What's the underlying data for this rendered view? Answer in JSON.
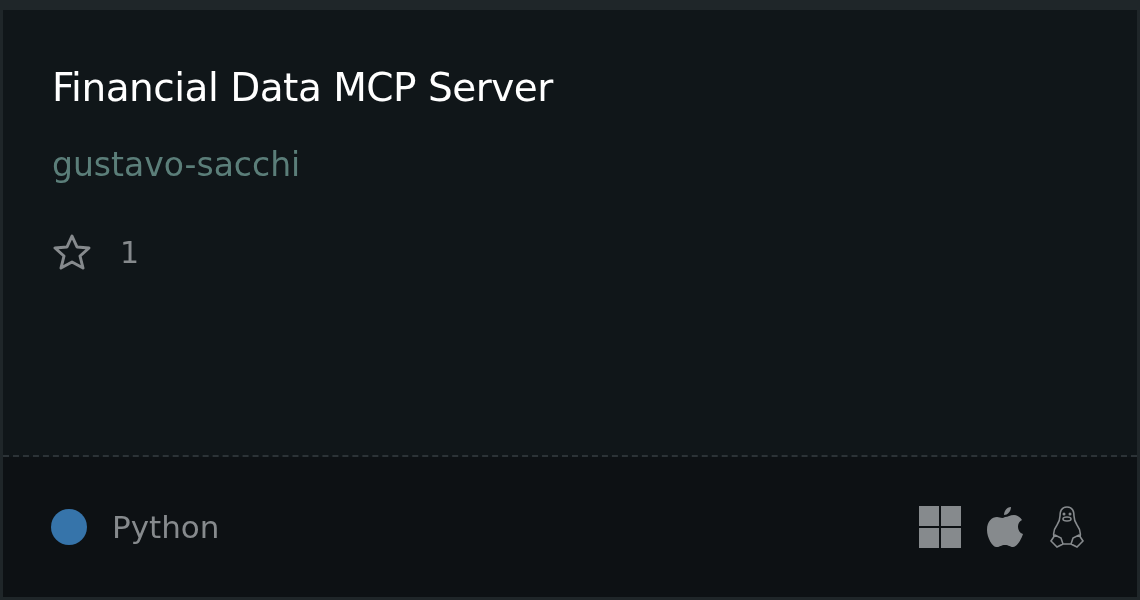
{
  "card": {
    "title": "Financial Data MCP Server",
    "author": "gustavo-sacchi",
    "star_count": "1"
  },
  "footer": {
    "language": {
      "name": "Python",
      "color": "#3674aa"
    },
    "platforms": [
      {
        "kind": "windows"
      },
      {
        "kind": "apple"
      },
      {
        "kind": "linux"
      }
    ]
  }
}
